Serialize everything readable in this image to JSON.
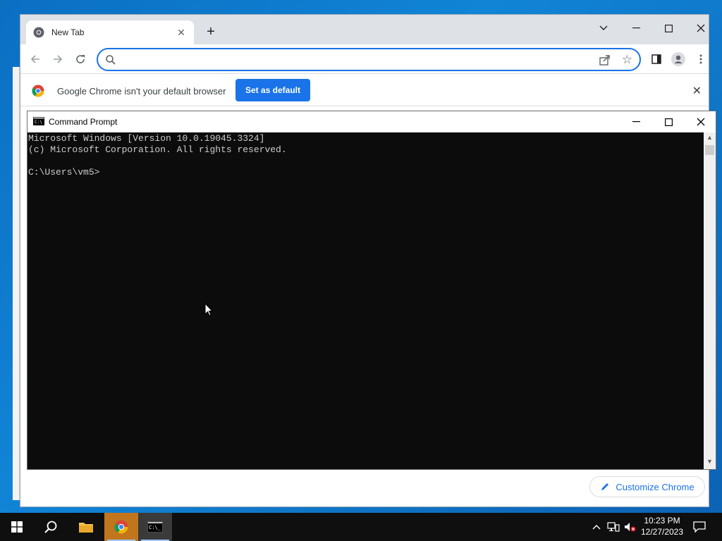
{
  "chrome": {
    "tab_title": "New Tab",
    "tab_close": "✕",
    "new_tab": "+",
    "controls": {
      "dropdown": "⌄",
      "minimize": "—",
      "maximize": "☐",
      "close": "✕"
    },
    "omnibox": {
      "value": "",
      "placeholder": ""
    },
    "icons": {
      "back": "arrow-left-icon",
      "forward": "arrow-right-icon",
      "reload": "reload-icon",
      "share": "share-icon",
      "bookmark": "star-icon",
      "side_panel": "side-panel-icon",
      "profile": "profile-icon",
      "menu": "kebab-menu-icon"
    },
    "infobar": {
      "message": "Google Chrome isn't your default browser",
      "button": "Set as default",
      "close": "✕"
    },
    "customize_button": "Customize Chrome"
  },
  "cmd": {
    "title": "Command Prompt",
    "lines": [
      "Microsoft Windows [Version 10.0.19045.3324]",
      "(c) Microsoft Corporation. All rights reserved.",
      "",
      "C:\\Users\\vm5>"
    ],
    "controls": {
      "minimize": "—",
      "maximize": "☐",
      "close": "✕"
    }
  },
  "taskbar": {
    "items": [
      "start-icon",
      "search-icon",
      "file-explorer-icon",
      "chrome-icon",
      "command-prompt-icon"
    ],
    "time": "10:23 PM",
    "date": "12/27/2023"
  },
  "colors": {
    "accent": "#1a73e8",
    "taskbar": "#0f0f0f",
    "console_bg": "#0c0c0c",
    "console_fg": "#cccccc"
  }
}
